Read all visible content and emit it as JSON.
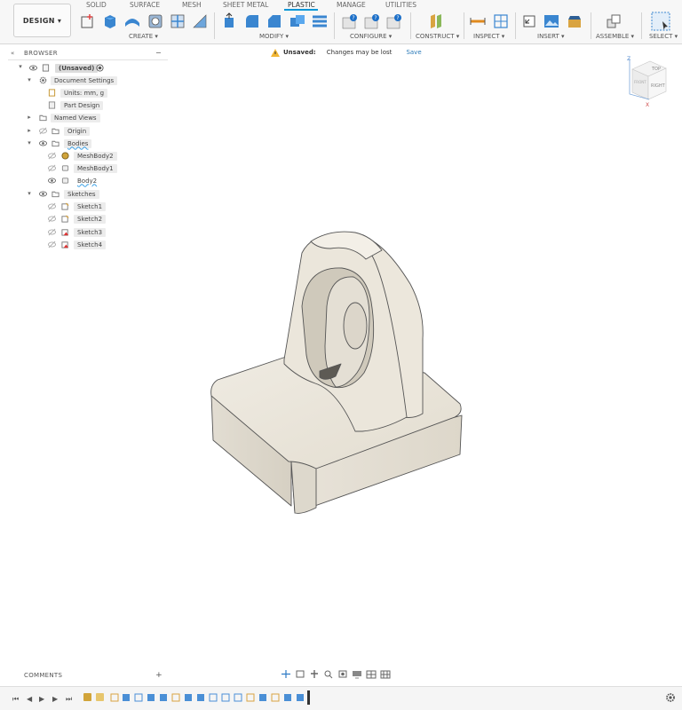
{
  "workspace": {
    "label": "DESIGN ▾"
  },
  "tabs": [
    {
      "label": "SOLID"
    },
    {
      "label": "SURFACE"
    },
    {
      "label": "MESH"
    },
    {
      "label": "SHEET METAL"
    },
    {
      "label": "PLASTIC",
      "active": true
    },
    {
      "label": "MANAGE"
    },
    {
      "label": "UTILITIES"
    }
  ],
  "groups": [
    {
      "label": "CREATE ▾"
    },
    {
      "label": "MODIFY ▾"
    },
    {
      "label": "CONFIGURE ▾"
    },
    {
      "label": "CONSTRUCT ▾"
    },
    {
      "label": "INSPECT ▾"
    },
    {
      "label": "INSERT ▾"
    },
    {
      "label": "ASSEMBLE ▾"
    },
    {
      "label": "SELECT ▾"
    }
  ],
  "browser": {
    "title": "BROWSER",
    "collapse": "−",
    "tree": [
      {
        "label": "(Unsaved)"
      },
      {
        "label": "Document Settings"
      },
      {
        "label": "Units: mm, g"
      },
      {
        "label": "Part Design"
      },
      {
        "label": "Named Views"
      },
      {
        "label": "Origin"
      },
      {
        "label": "Bodies"
      },
      {
        "label": "MeshBody2"
      },
      {
        "label": "MeshBody1"
      },
      {
        "label": "Body2"
      },
      {
        "label": "Sketches"
      },
      {
        "label": "Sketch1"
      },
      {
        "label": "Sketch2"
      },
      {
        "label": "Sketch3"
      },
      {
        "label": "Sketch4"
      }
    ]
  },
  "warning": {
    "label": "Unsaved:",
    "message": "Changes may be lost",
    "save": "Save"
  },
  "viewcube": {
    "top": "TOP",
    "right": "RIGHT",
    "front": "FRONT",
    "x": "X",
    "z": "Z"
  },
  "comments": {
    "label": "COMMENTS",
    "add": "+"
  },
  "colors": {
    "accent": "#0696d7",
    "body": "#e9e5dc",
    "warning": "#f2b632"
  },
  "icons": [
    "chevron-double-left-icon",
    "eye-icon",
    "folder-icon",
    "gear-icon",
    "document-icon",
    "mesh-body-icon",
    "sketch-icon",
    "play-icon",
    "settings-gear-icon"
  ]
}
